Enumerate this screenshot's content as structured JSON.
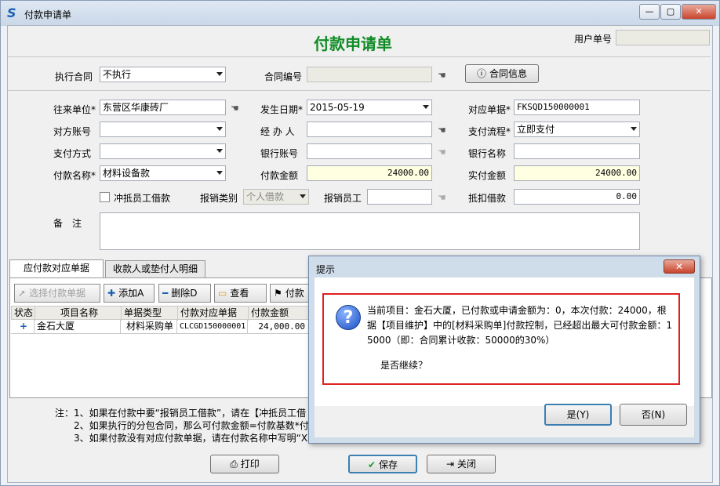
{
  "window": {
    "title": "付款申请单",
    "form_title": "付款申请单",
    "user_no_label": "用户单号",
    "user_no_value": ""
  },
  "top": {
    "exec_contract_label": "执行合同",
    "exec_contract_value": "不执行",
    "contract_no_label": "合同编号",
    "contract_no_value": "",
    "contract_info_button": "合同信息"
  },
  "form": {
    "partner_label": "往来单位*",
    "partner_value": "东营区华康砖厂",
    "date_label": "发生日期*",
    "date_value": "2015-05-19",
    "ref_doc_label": "对应单据*",
    "ref_doc_value": "FKSQD150000001",
    "account_label": "对方账号",
    "account_value": "",
    "handler_label": "经 办 人",
    "handler_value": "",
    "flow_label": "支付流程*",
    "flow_value": "立即支付",
    "pay_method_label": "支付方式",
    "pay_method_value": "",
    "bank_account_label": "银行账号",
    "bank_account_value": "",
    "bank_name_label": "银行名称",
    "bank_name_value": "",
    "pay_name_label": "付款名称*",
    "pay_name_value": "材料设备款",
    "pay_amount_label": "付款金额",
    "pay_amount_value": "24000.00",
    "actual_amount_label": "实付金额",
    "actual_amount_value": "24000.00",
    "offset_loan_label": "冲抵员工借款",
    "reimb_type_label": "报销类别",
    "reimb_type_value": "个人借款",
    "reimb_emp_label": "报销员工",
    "reimb_emp_value": "",
    "deduct_loan_label": "抵扣借款",
    "deduct_loan_value": "0.00",
    "remark_label": "备　注",
    "remark_value": ""
  },
  "tabs": [
    "应付款对应单据",
    "收款人或垫付人明细"
  ],
  "toolbar": {
    "select_doc": "选择付款单据",
    "add": "添加A",
    "delete": "删除D",
    "view": "查看",
    "pay": "付款"
  },
  "grid": {
    "headers": [
      "状态",
      "项目名称",
      "单据类型",
      "付款对应单据",
      "付款金额"
    ],
    "rows": [
      {
        "status": "+",
        "project": "金石大厦",
        "doc_type": "材料采购单",
        "doc_no": "CLCGD150000001",
        "amount": "24,000.00"
      }
    ]
  },
  "notes": [
    "注：1、如果在付款中要“报销员工借款”，请在【冲抵员工借",
    "2、如果执行的分包合同，那么可付款金额=付款基数*付款",
    "3、如果付款没有对应付款单据，请在付款名称中写明“XX"
  ],
  "footer": {
    "print": "打印",
    "save": "保存",
    "close": "关闭"
  },
  "dialog": {
    "title": "提示",
    "message": "当前项目：金石大厦，已付款或申请金额为：0，本次付款：24000，根据【项目维护】中的[材料采购单]付款控制，已经超出最大可付款金额：15000（即：合同累计收款：50000的30%）",
    "question": "是否继续？",
    "yes": "是(Y)",
    "no": "否(N)"
  },
  "colors": {
    "title_green": "#118c27",
    "alert_red": "#e02020",
    "amount_bg": "#ffffe1"
  }
}
